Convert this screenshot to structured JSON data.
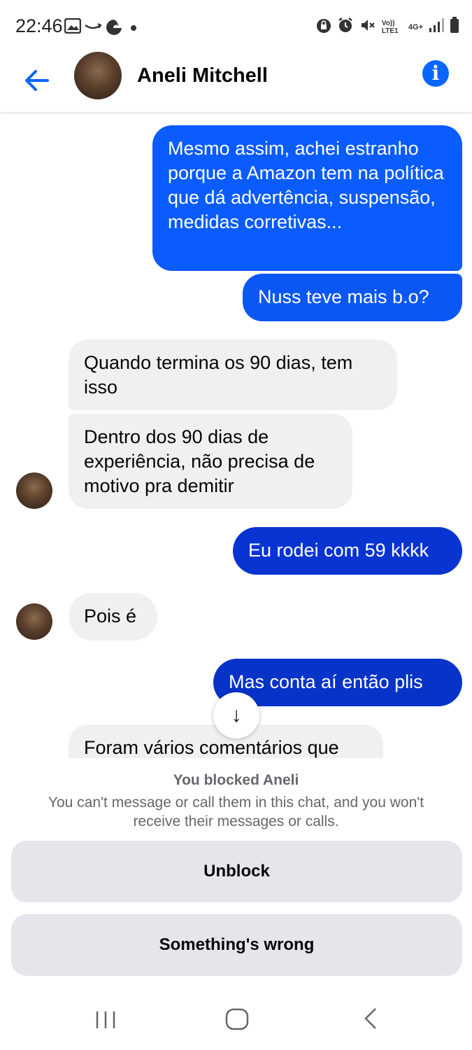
{
  "status_bar": {
    "time": "22:46",
    "left_icons": [
      "image-icon",
      "amazon-icon",
      "edge-browser-icon",
      "dot-icon"
    ],
    "right_icons": [
      "lock-icon",
      "alarm-icon",
      "mute-icon",
      "volte-icon",
      "4g-icon",
      "signal-icon",
      "battery-icon"
    ],
    "volte_label": "Vo)) LTE1",
    "network_label": "4G+"
  },
  "header": {
    "contact_name": "Aneli Mitchell",
    "info_glyph": "i",
    "accent_color": "#0866ff"
  },
  "messages": [
    {
      "side": "out",
      "text": "Mesmo assim, achei estranho porque a Amazon tem na política que dá advertência, suspensão, medidas corretivas..."
    },
    {
      "side": "out",
      "text": "Nuss teve mais b.o?"
    },
    {
      "side": "in",
      "text": "Quando termina os 90 dias, tem isso"
    },
    {
      "side": "in",
      "text": "Dentro dos 90 dias de experiência, não precisa de motivo pra demitir"
    },
    {
      "side": "out",
      "text": "Eu rodei com 59 kkkk"
    },
    {
      "side": "in",
      "text": "Pois é"
    },
    {
      "side": "out",
      "text": "Mas conta aí então plis"
    },
    {
      "side": "in",
      "text": "Foram vários comentários que"
    }
  ],
  "scroll_button_glyph": "↓",
  "blocked": {
    "title": "You blocked Aneli",
    "description": "You can't message or call them in this chat, and you won't receive their messages or calls.",
    "unblock_label": "Unblock",
    "wrong_label": "Something's wrong"
  },
  "nav": {
    "recents_icon": "recents-icon",
    "home_icon": "home-icon",
    "back_icon": "back-icon"
  },
  "colors": {
    "outgoing_top": "#0a5cff",
    "outgoing_bottom": "#0033c8",
    "incoming": "#f0f0f0",
    "panel_button": "#e4e6eb"
  }
}
